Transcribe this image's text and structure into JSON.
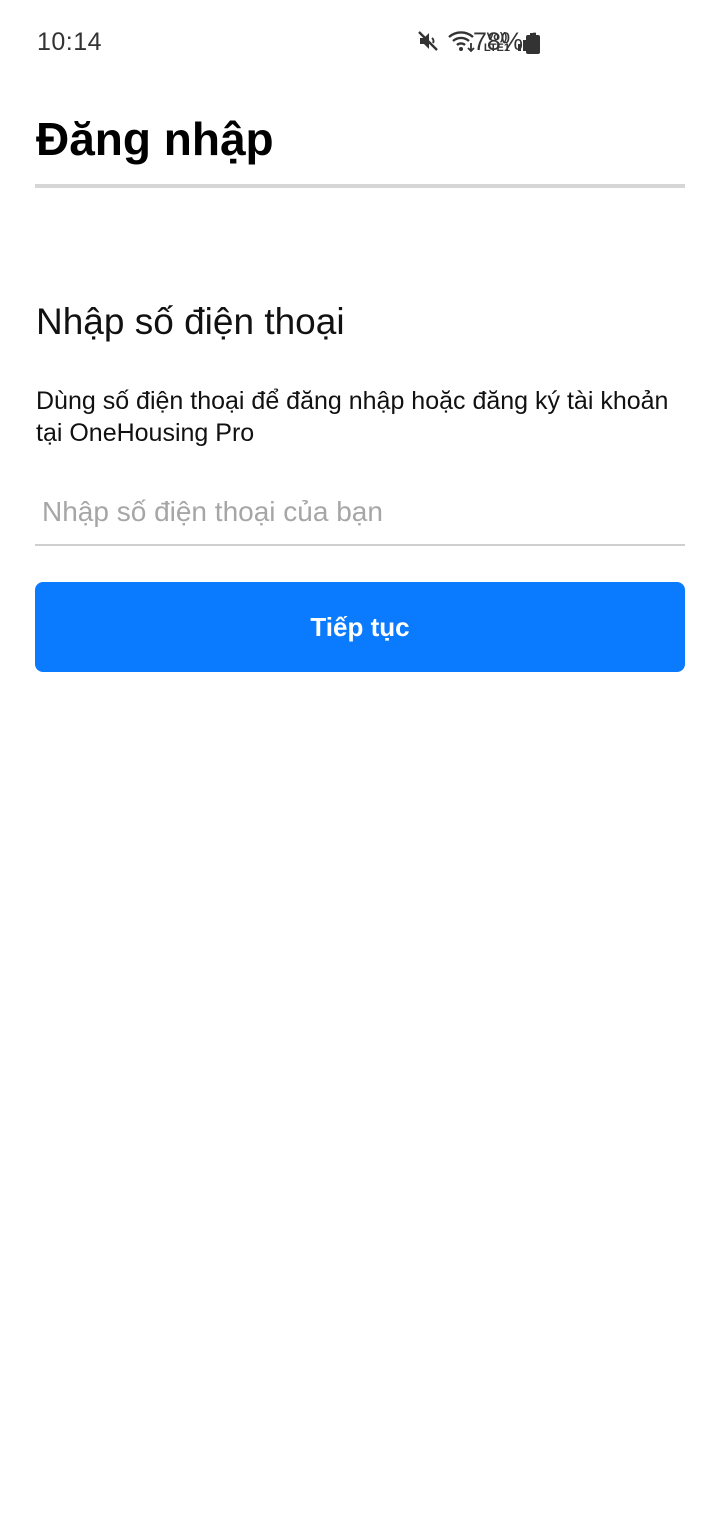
{
  "status_bar": {
    "time": "10:14",
    "battery_percent": "78%",
    "network_label_top": "Vo))",
    "network_label_bottom": "LTE1",
    "icons": [
      "mute-icon",
      "wifi-icon",
      "volte-icon",
      "signal-icon",
      "battery-icon"
    ]
  },
  "header": {
    "title": "Đăng nhập"
  },
  "login": {
    "heading": "Nhập số điện thoại",
    "description": "Dùng số điện thoại để đăng nhập hoặc đăng ký tài khoản tại OneHousing Pro",
    "phone_value": "",
    "phone_placeholder": "Nhập số điện thoại của bạn",
    "continue_label": "Tiếp tục"
  },
  "colors": {
    "primary_button": "#0a7bff",
    "divider": "#d6d6d6",
    "placeholder": "#a6a6a6"
  }
}
